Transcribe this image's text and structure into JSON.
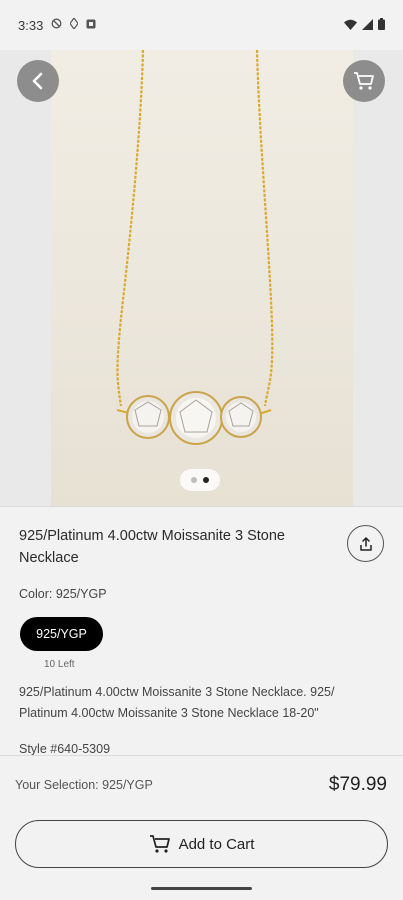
{
  "status_bar": {
    "time": "3:33",
    "left_icons": [
      "do-not-disturb-icon",
      "data-saver-icon",
      "notification-icon"
    ],
    "right_icons": [
      "wifi-icon",
      "signal-icon",
      "battery-icon"
    ]
  },
  "hero": {
    "image_alt": "Gold chain necklace with three round moissanite stones",
    "page_count": 2,
    "active_page": 2
  },
  "product": {
    "title": "925/Platinum 4.00ctw Moissanite 3 Stone Necklace",
    "color_label": "Color: 925/YGP",
    "color_option": "925/YGP",
    "stock": "10 Left",
    "description": "925/Platinum 4.00ctw Moissanite 3 Stone Necklace. 925/ Platinum 4.00ctw Moissanite 3 Stone Necklace 18-20\"",
    "style_number": "Style #640-5309"
  },
  "footer": {
    "selection": "Your Selection: 925/YGP",
    "price": "$79.99",
    "add_to_cart": "Add to Cart"
  },
  "colors": {
    "pill_bg": "#000000",
    "chain_gold": "#d9a92e"
  }
}
